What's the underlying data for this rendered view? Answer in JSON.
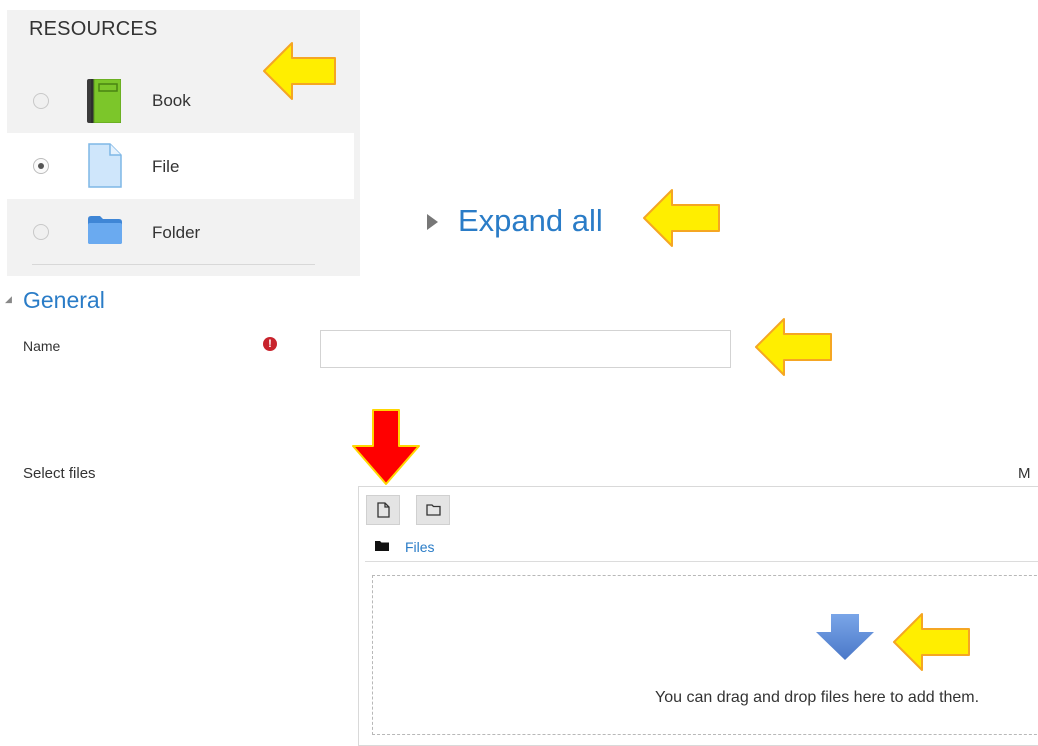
{
  "resources": {
    "title": "RESOURCES",
    "items": [
      {
        "label": "Book",
        "icon": "book-icon",
        "checked": false
      },
      {
        "label": "File",
        "icon": "file-icon",
        "checked": true
      },
      {
        "label": "Folder",
        "icon": "folder-icon",
        "checked": false
      }
    ]
  },
  "expand": {
    "label": "Expand all"
  },
  "general": {
    "title": "General",
    "name_label": "Name",
    "name_value": "",
    "required_icon": "exclamation-circle-icon"
  },
  "files": {
    "label": "Select files",
    "max_size_label": "M",
    "toolbar": [
      {
        "icon": "add-file-icon"
      },
      {
        "icon": "create-folder-icon"
      }
    ],
    "path_label": "Files",
    "drop_text": "You can drag and drop files here to add them.",
    "drop_icon": "down-arrow-icon"
  },
  "annotations": [
    {
      "icon": "yellow-arrow-icon",
      "color": "#ffee00"
    },
    {
      "icon": "red-arrow-icon",
      "color": "#ff0000"
    }
  ],
  "colors": {
    "link": "#2a7cc7",
    "panel_bg": "#f2f2f2",
    "required": "#c8232c",
    "annotation_yellow": "#ffee00",
    "annotation_orange_outline": "#f5a623",
    "annotation_red": "#ff0000"
  }
}
